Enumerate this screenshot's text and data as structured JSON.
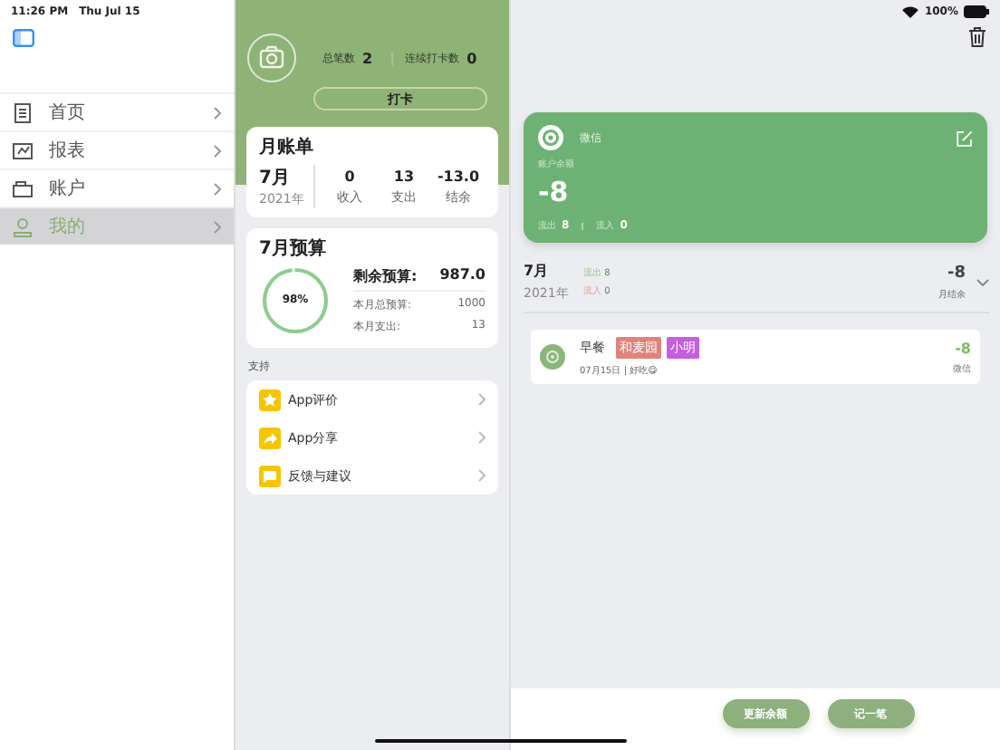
{
  "status_bar": {
    "time": "11:26 PM",
    "date": "Thu Jul 15",
    "battery": "100%"
  },
  "sidebar": {
    "items": [
      {
        "label": "首页",
        "selected": false
      },
      {
        "label": "报表",
        "selected": false
      },
      {
        "label": "账户",
        "selected": false
      },
      {
        "label": "我的",
        "selected": true
      }
    ]
  },
  "profile": {
    "total_label": "总笔数",
    "total": "2",
    "streak_label": "连续打卡数",
    "streak": "0",
    "checkin_button": "打卡"
  },
  "monthly_bill": {
    "title": "月账单",
    "month": "7月",
    "year": "2021年",
    "stats": [
      {
        "value": "0",
        "label": "收入"
      },
      {
        "value": "13",
        "label": "支出"
      },
      {
        "value": "-13.0",
        "label": "结余"
      }
    ]
  },
  "budget": {
    "title": "7月预算",
    "percent": "98%",
    "level": 0.98,
    "remaining_label": "剩余预算:",
    "remaining": "987.0",
    "rows": [
      {
        "label": "本月总预算:",
        "value": "1000"
      },
      {
        "label": "本月支出:",
        "value": "13"
      }
    ]
  },
  "support": {
    "title": "支持",
    "items": [
      {
        "label": "App评价"
      },
      {
        "label": "App分享"
      },
      {
        "label": "反馈与建议"
      }
    ]
  },
  "account_card": {
    "name": "微信",
    "balance_label": "账户余额",
    "balance": "-8",
    "out_label": "流出",
    "out": "8",
    "in_label": "流入",
    "in": "0"
  },
  "month_summary": {
    "month": "7月",
    "year": "2021年",
    "out_label": "流出",
    "out": "8",
    "in_label": "流入",
    "in": "0",
    "balance": "-8",
    "balance_label": "月结余",
    "expanded": true
  },
  "transactions": [
    {
      "title": "早餐",
      "tags": [
        {
          "label": "和麦园",
          "color": "#e0837a"
        },
        {
          "label": "小明",
          "color": "#c55ee0"
        }
      ],
      "note": "07月15日 | 好吃😋",
      "amount": "-8",
      "account": "微信"
    }
  ],
  "bottom_buttons": [
    "更新余额",
    "记一笔"
  ]
}
